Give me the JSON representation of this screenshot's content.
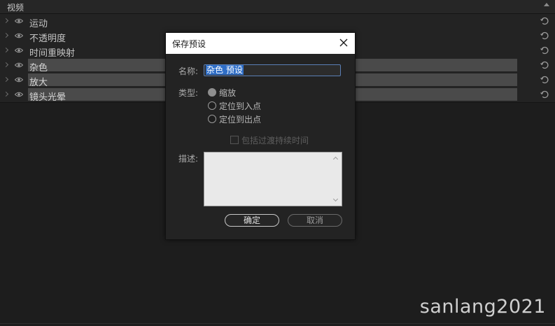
{
  "panel": {
    "section_title": "视频",
    "rows": [
      {
        "label": "运动",
        "highlighted": false
      },
      {
        "label": "不透明度",
        "highlighted": false
      },
      {
        "label": "时间重映射",
        "highlighted": false
      },
      {
        "label": "杂色",
        "highlighted": true
      },
      {
        "label": "放大",
        "highlighted": true
      },
      {
        "label": "镜头光晕",
        "highlighted": true
      }
    ]
  },
  "dialog": {
    "title": "保存预设",
    "name_label": "名称:",
    "name_value": "杂色 预设",
    "type_label": "类型:",
    "type_options": [
      {
        "label": "缩放",
        "checked": true
      },
      {
        "label": "定位到入点",
        "checked": false
      },
      {
        "label": "定位到出点",
        "checked": false
      }
    ],
    "include_duration_label": "包括过渡持续时间",
    "description_label": "描述:",
    "ok_label": "确定",
    "cancel_label": "取消"
  },
  "watermark": "sanlang2021",
  "colors": {
    "background": "#1d1d1d",
    "highlight_bar": "#4a4a4a",
    "selection": "#2f6ec7",
    "dialog_titlebar": "#ffffff"
  }
}
